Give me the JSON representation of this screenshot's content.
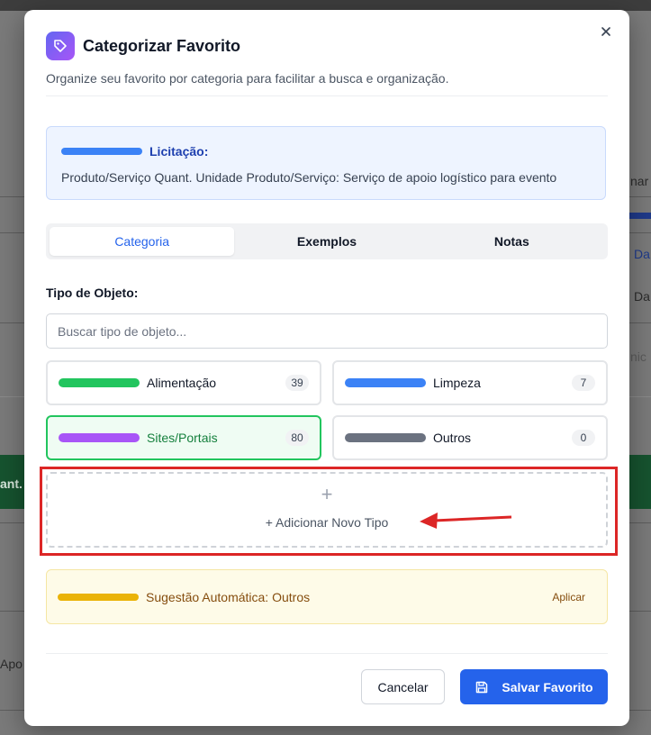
{
  "background": {
    "fragments": [
      "nar",
      "Da",
      "Da",
      "nic",
      "ant.",
      "Apo"
    ]
  },
  "modal": {
    "title": "Categorizar Favorito",
    "subtitle": "Organize seu favorito por categoria para facilitar a busca e organização.",
    "close_icon": "close-icon",
    "title_icon": "tag-icon"
  },
  "licitacao": {
    "label": "Licitação:",
    "description": "Produto/Serviço Quant. Unidade Produto/Serviço: Serviço de apoio logístico para evento",
    "color": "#3b82f6"
  },
  "tabs": [
    {
      "label": "Categoria",
      "active": true
    },
    {
      "label": "Exemplos",
      "active": false
    },
    {
      "label": "Notas",
      "active": false
    }
  ],
  "tipo_objeto": {
    "label": "Tipo de Objeto:",
    "search_placeholder": "Buscar tipo de objeto...",
    "search_value": "",
    "types": [
      {
        "label": "Alimentação",
        "count": "39",
        "color": "#22c55e",
        "selected": false
      },
      {
        "label": "Limpeza",
        "count": "7",
        "color": "#3b82f6",
        "selected": false
      },
      {
        "label": "Sites/Portais",
        "count": "80",
        "color": "#a855f7",
        "selected": true
      },
      {
        "label": "Outros",
        "count": "0",
        "color": "#6b7280",
        "selected": false
      }
    ],
    "add_plus": "+",
    "add_label": "+ Adicionar Novo Tipo"
  },
  "suggestion": {
    "label": "Sugestão Automática: Outros",
    "action": "Aplicar",
    "color": "#eab308"
  },
  "footer": {
    "cancel_label": "Cancelar",
    "save_label": "Salvar Favorito",
    "save_icon": "save-icon"
  },
  "colors": {
    "accent": "#2563eb",
    "highlight": "#dc2626"
  }
}
